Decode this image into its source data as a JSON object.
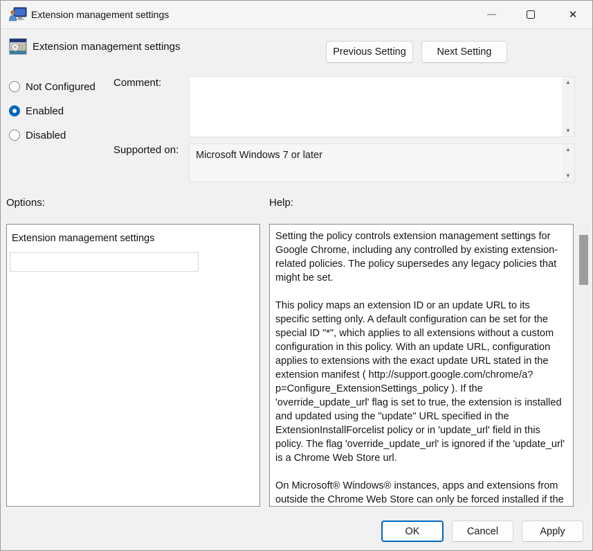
{
  "window": {
    "title": "Extension management settings",
    "icons": {
      "app_icon": "user-monitor-icon",
      "minimize": "–",
      "maximize": "□",
      "close": "✕"
    }
  },
  "header": {
    "policy_icon": "group-policy-setting-icon",
    "setting_name": "Extension management settings",
    "previous_button": "Previous Setting",
    "next_button": "Next Setting"
  },
  "state": {
    "options": [
      {
        "label": "Not Configured",
        "selected": false
      },
      {
        "label": "Enabled",
        "selected": true
      },
      {
        "label": "Disabled",
        "selected": false
      }
    ],
    "comment_label": "Comment:",
    "comment_value": "",
    "supported_label": "Supported on:",
    "supported_value": "Microsoft Windows 7 or later"
  },
  "icons": {
    "scroll_up": "▲",
    "scroll_down": "▼"
  },
  "options_section": {
    "label": "Options:",
    "field_label": "Extension management settings",
    "field_value": ""
  },
  "help_section": {
    "label": "Help:",
    "paragraphs": [
      "Setting the policy controls extension management settings for Google Chrome, including any controlled by existing extension-related policies. The policy supersedes any legacy policies that might be set.",
      "This policy maps an extension ID or an update URL to its specific setting only. A default configuration can be set for the special ID \"*\", which applies to all extensions without a custom configuration in this policy. With an update URL, configuration applies to extensions with the exact update URL stated in the extension manifest ( http://support.google.com/chrome/a?p=Configure_ExtensionSettings_policy ). If the 'override_update_url' flag is set to true, the extension is installed and updated using the \"update\" URL specified in the ExtensionInstallForcelist policy or in 'update_url' field in this policy. The flag 'override_update_url' is ignored if the 'update_url' is a Chrome Web Store url.",
      "On Microsoft® Windows® instances, apps and extensions from outside the Chrome Web Store can only be forced installed if the"
    ]
  },
  "footer": {
    "ok": "OK",
    "cancel": "Cancel",
    "apply": "Apply"
  },
  "colors": {
    "accent": "#0067C0",
    "dialog_bg": "#f1f1f1",
    "panel_border": "#8d8d8d"
  }
}
